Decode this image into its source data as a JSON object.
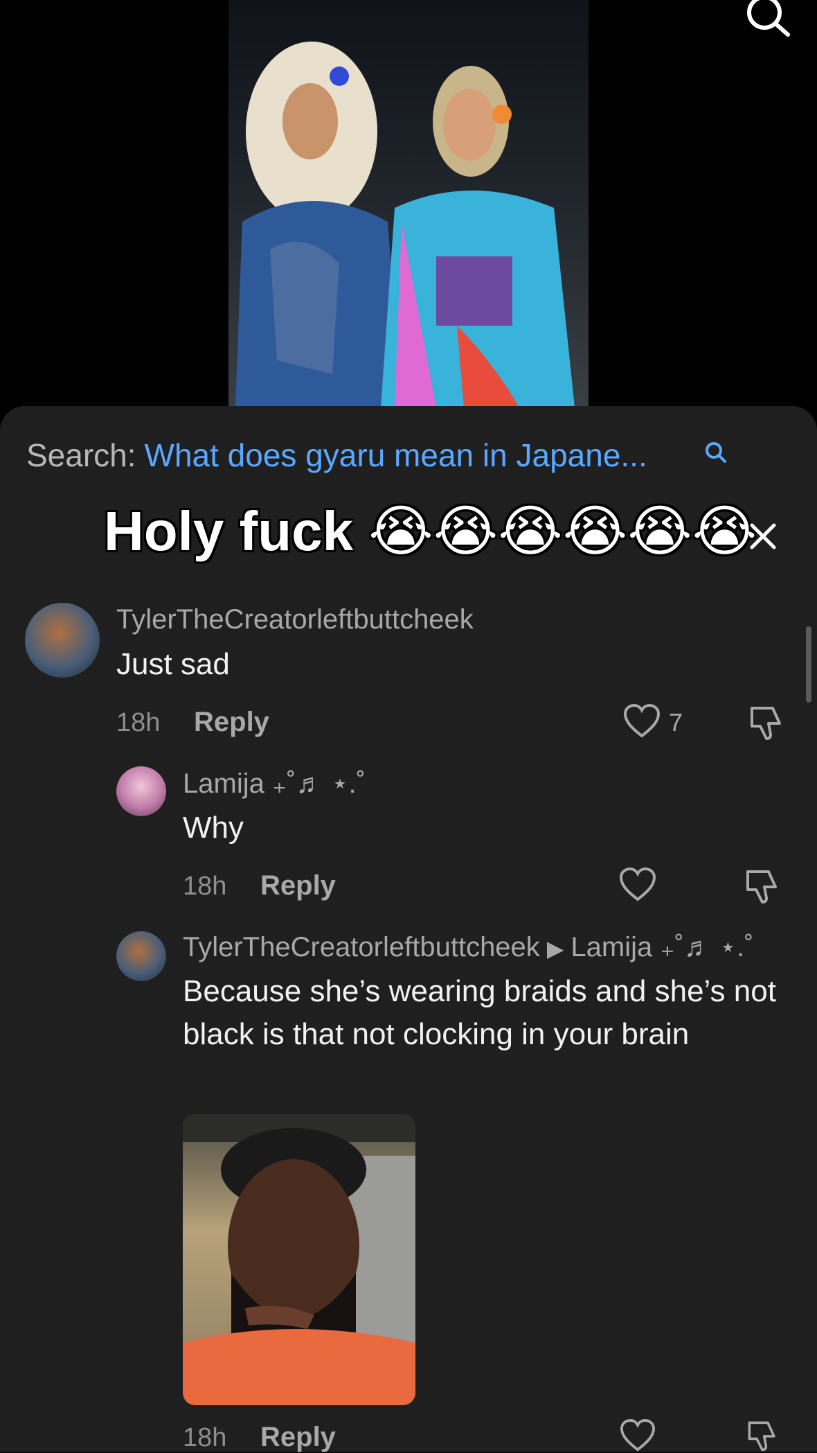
{
  "search": {
    "prefix": "Search:",
    "query": "What does gyaru mean in Japane..."
  },
  "overlay": {
    "caption": "Holy fuck 😭😭😭😭😭😭"
  },
  "comments": [
    {
      "username": "TylerTheCreatorleftbuttcheek",
      "text": "Just sad",
      "time": "18h",
      "reply_label": "Reply",
      "like_count": "7"
    },
    {
      "username": "Lamija ₊˚♬ ⋆.˚",
      "text": "Why",
      "time": "18h",
      "reply_label": "Reply"
    },
    {
      "username": "TylerTheCreatorleftbuttcheek",
      "reply_to": "Lamija ₊˚♬ ⋆.˚",
      "text": "Because she’s wearing braids and she’s not black is that not clocking in your brain",
      "time": "18h",
      "reply_label": "Reply"
    }
  ],
  "colors": {
    "link_blue": "#5aa8ff",
    "sheet_bg": "#1f1f1f"
  },
  "icons": [
    "search-icon",
    "close-icon",
    "heart-icon",
    "dislike-icon"
  ]
}
